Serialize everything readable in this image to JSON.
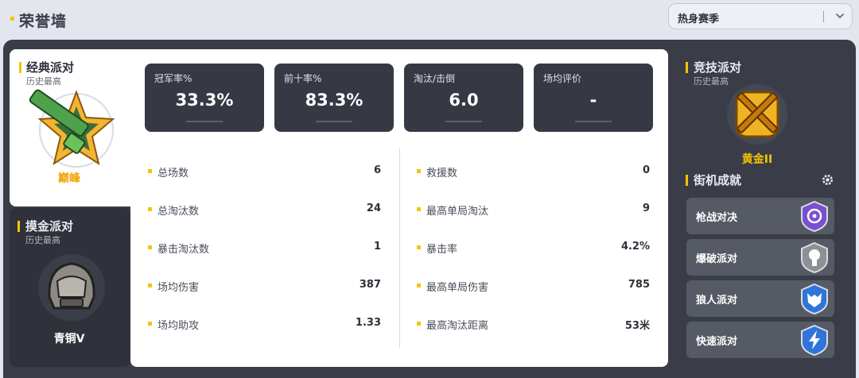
{
  "header": {
    "title": "荣誉墙"
  },
  "season_select": {
    "selected": "热身赛季"
  },
  "classic_party": {
    "title": "经典派对",
    "subtitle": "历史最高",
    "rank": "巅峰"
  },
  "gold_party": {
    "title": "摸金派对",
    "subtitle": "历史最高",
    "rank": "青铜V"
  },
  "highlights": [
    {
      "label": "冠军率%",
      "value": "33.3%"
    },
    {
      "label": "前十率%",
      "value": "83.3%"
    },
    {
      "label": "淘汰/击倒",
      "value": "6.0"
    },
    {
      "label": "场均评价",
      "value": "-"
    }
  ],
  "stats_left": [
    {
      "label": "总场数",
      "value": "6"
    },
    {
      "label": "总淘汰数",
      "value": "24"
    },
    {
      "label": "暴击淘汰数",
      "value": "1"
    },
    {
      "label": "场均伤害",
      "value": "387"
    },
    {
      "label": "场均助攻",
      "value": "1.33"
    }
  ],
  "stats_right": [
    {
      "label": "救援数",
      "value": "0"
    },
    {
      "label": "最高单局淘汰",
      "value": "9"
    },
    {
      "label": "暴击率",
      "value": "4.2%"
    },
    {
      "label": "最高单局伤害",
      "value": "785"
    },
    {
      "label": "最高淘汰距离",
      "value": "53米"
    }
  ],
  "competitive_party": {
    "title": "竞技派对",
    "subtitle": "历史最高",
    "rank": "黄金II"
  },
  "arcade": {
    "title": "街机成就",
    "items": [
      {
        "label": "枪战对决",
        "badge_color": "#7a4fd0"
      },
      {
        "label": "爆破派对",
        "badge_color": "#8e9096"
      },
      {
        "label": "狼人派对",
        "badge_color": "#2f74d8"
      },
      {
        "label": "快速派对",
        "badge_color": "#2f74d8"
      }
    ]
  },
  "colors": {
    "accent": "#f5c500",
    "panel": "#3a3d47",
    "tile": "#363944"
  }
}
